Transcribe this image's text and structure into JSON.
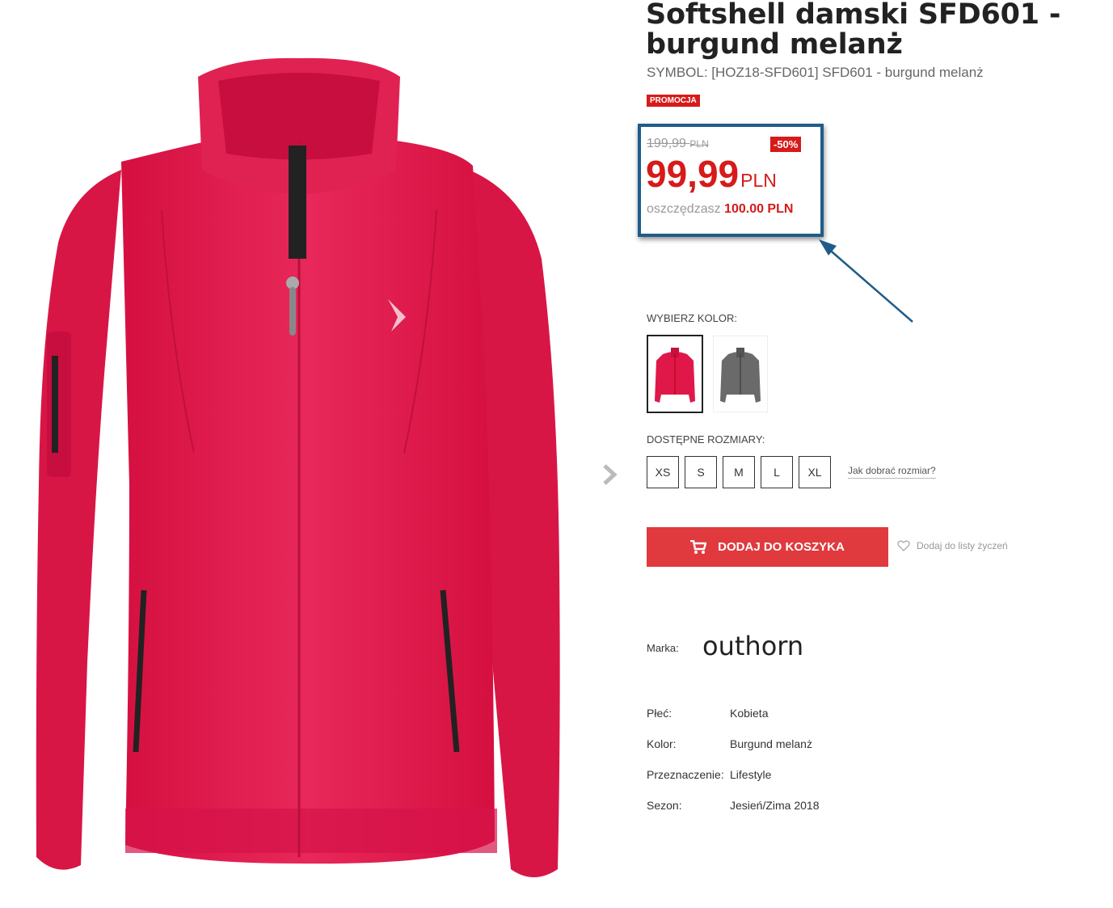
{
  "product": {
    "title": "Softshell damski SFD601 - burgund melanż",
    "symbol": "SYMBOL: [HOZ18-SFD601] SFD601 - burgund melanż",
    "promo_badge": "PROMOCJA"
  },
  "price": {
    "old_value": "199,99",
    "old_currency": "PLN",
    "discount": "-50%",
    "new_value": "99,99",
    "new_currency": "PLN",
    "savings_label": "oszczędzasz",
    "savings_value": "100.00 PLN"
  },
  "color_selector": {
    "label": "WYBIERZ KOLOR:",
    "options": [
      {
        "name": "burgund",
        "color": "#e0184a"
      },
      {
        "name": "grey",
        "color": "#6a6a6a"
      }
    ]
  },
  "sizes": {
    "label": "DOSTĘPNE ROZMIARY:",
    "options": [
      "XS",
      "S",
      "M",
      "L",
      "XL"
    ],
    "guide_link": "Jak dobrać rozmiar?"
  },
  "cart": {
    "add_label": "DODAJ DO KOSZYKA",
    "wishlist_label": "Dodaj do listy życzeń"
  },
  "brand": {
    "label": "Marka:",
    "logo_text": "outhorn"
  },
  "specs": [
    {
      "key": "Płeć:",
      "value": "Kobieta"
    },
    {
      "key": "Kolor:",
      "value": "Burgund melanż"
    },
    {
      "key": "Przeznaczenie:",
      "value": "Lifestyle"
    },
    {
      "key": "Sezon:",
      "value": "Jesień/Zima 2018"
    }
  ],
  "colors": {
    "accent_red": "#d71a1a",
    "cart_button": "#e03a3e",
    "annotation_blue": "#1f5c8a",
    "jacket": "#e0184a"
  },
  "icons": [
    "chevron-right-icon",
    "cart-icon",
    "heart-icon",
    "annotation-arrow"
  ]
}
